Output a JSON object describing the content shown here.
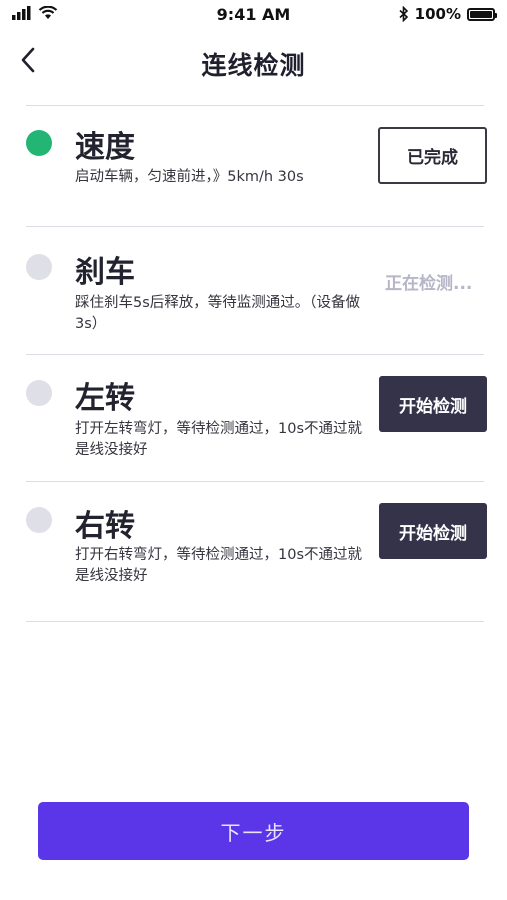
{
  "status_bar": {
    "time": "9:41 AM",
    "battery": "100%",
    "icons": [
      "signal-icon",
      "wifi-icon",
      "bluetooth-icon",
      "battery-icon"
    ]
  },
  "nav": {
    "title": "连线检测",
    "back_icon": "chevron-left-icon"
  },
  "items": [
    {
      "title": "速度",
      "desc": "启动车辆，匀速前进，》5km/h   30s",
      "state": "done",
      "action": "已完成"
    },
    {
      "title": "刹车",
      "desc": "踩住刹车5s后释放，等待监测通过。（设备做3s）",
      "state": "checking",
      "action": "正在检测..."
    },
    {
      "title": "左转",
      "desc": "打开左转弯灯，等待检测通过，10s不通过就是线没接好",
      "state": "pending",
      "action": "开始检测"
    },
    {
      "title": "右转",
      "desc": "打开右转弯灯，等待检测通过，10s不通过就是线没接好",
      "state": "pending",
      "action": "开始检测"
    }
  ],
  "footer": {
    "next_label": "下一步"
  },
  "colors": {
    "done_dot": "#22b573",
    "pending_dot": "#dfdfe8",
    "primary": "#5a36e8",
    "dark_button": "#35334a",
    "checking_text": "#b6b6c8"
  }
}
